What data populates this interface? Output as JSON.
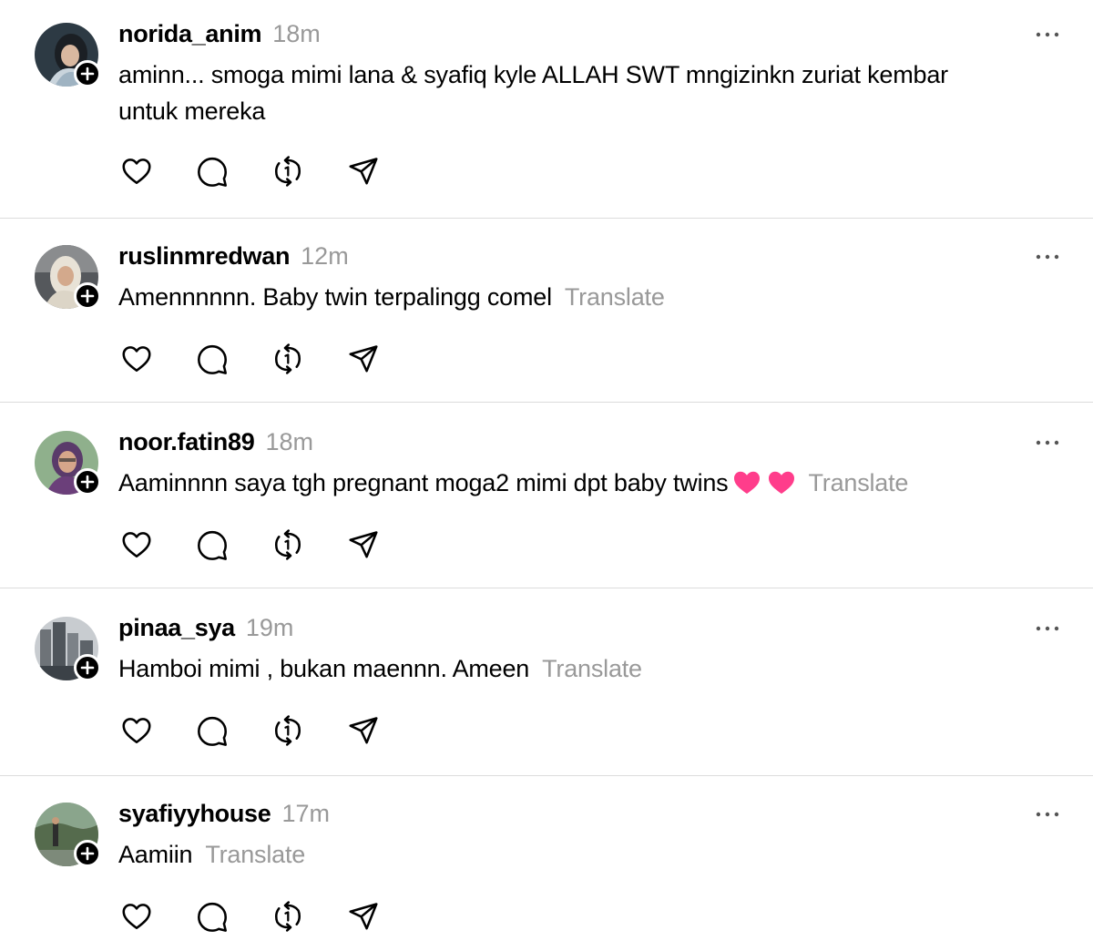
{
  "posts": [
    {
      "username": "norida_anim",
      "time": "18m",
      "text_lines": [
        "aminn... smoga mimi lana & syafiq kyle ALLAH SWT mngizinkn zuriat kembar",
        "untuk mereka"
      ],
      "translate": "",
      "emoji": ""
    },
    {
      "username": "ruslinmredwan",
      "time": "12m",
      "text_lines": [
        "Amennnnnn. Baby twin terpalingg comel"
      ],
      "translate": "Translate",
      "emoji": ""
    },
    {
      "username": "noor.fatin89",
      "time": "18m",
      "text_lines": [
        "Aaminnnn saya tgh pregnant moga2 mimi dpt baby twins"
      ],
      "translate": "Translate",
      "emoji": "❤❤"
    },
    {
      "username": "pinaa_sya",
      "time": "19m",
      "text_lines": [
        "Hamboi mimi , bukan maennn. Ameen"
      ],
      "translate": "Translate",
      "emoji": ""
    },
    {
      "username": "syafiyyhouse",
      "time": "17m",
      "text_lines": [
        "Aamiin"
      ],
      "translate": "Translate",
      "emoji": ""
    }
  ],
  "icons": {
    "like": "heart-icon",
    "reply": "comment-icon",
    "repost": "repost-icon",
    "share": "send-icon",
    "more": "more-icon",
    "follow": "plus-icon"
  },
  "colors": {
    "text": "#000000",
    "muted": "#999999",
    "divider": "#dcdcdc",
    "emoji_heart": "#ff3d8b"
  }
}
